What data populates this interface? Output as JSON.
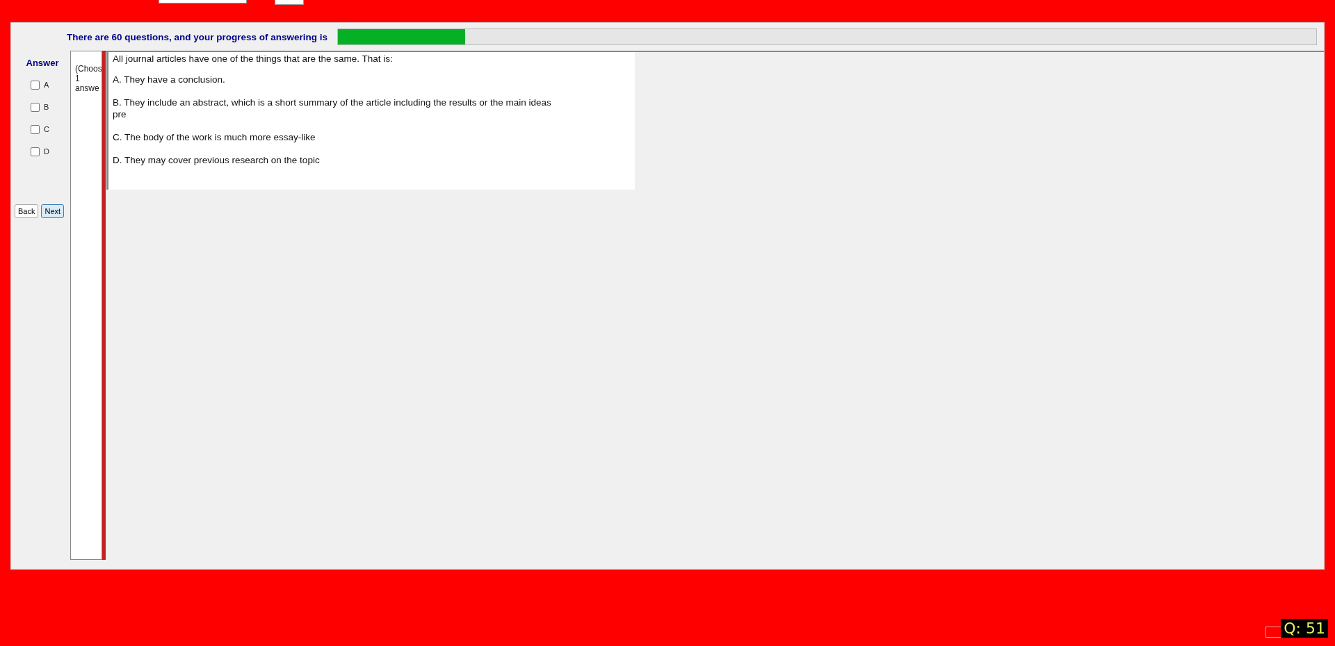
{
  "progress": {
    "label": "There are 60 questions, and your progress of answering is",
    "level": 0.13
  },
  "answer": {
    "title": "Answer",
    "options": [
      {
        "label": "A",
        "checked": false
      },
      {
        "label": "B",
        "checked": false
      },
      {
        "label": "C",
        "checked": false
      },
      {
        "label": "D",
        "checked": false
      }
    ]
  },
  "buttons": [
    {
      "label": "Back",
      "kind": "plain"
    },
    {
      "label": "Next",
      "kind": "focused"
    }
  ],
  "instruction_lines": [
    "(Choos",
    "1",
    "answe"
  ],
  "question": {
    "stem": "All journal articles have one of the things that are the same. That is:",
    "choices": [
      "A.  They have a conclusion.",
      "B.  They include an abstract, which is a short summary of the article including the results or the main ideas\npre",
      "C.  The body of the work is much more essay-like",
      "D.  They may cover previous research on the topic"
    ]
  },
  "question_counter": "Q: 51"
}
